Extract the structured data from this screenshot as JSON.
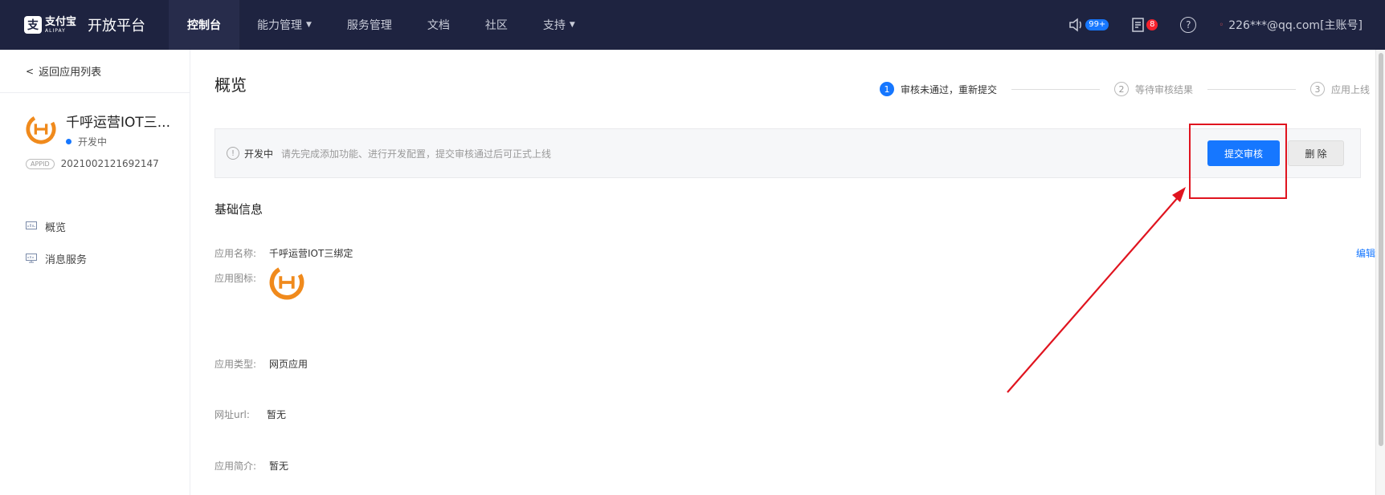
{
  "nav": {
    "brand_cn": "支付宝",
    "brand_en": "ALIPAY",
    "title": "开放平台",
    "items": [
      {
        "label": "控制台",
        "active": true,
        "dropdown": false
      },
      {
        "label": "能力管理",
        "active": false,
        "dropdown": true
      },
      {
        "label": "服务管理",
        "active": false,
        "dropdown": false
      },
      {
        "label": "文档",
        "active": false,
        "dropdown": false
      },
      {
        "label": "社区",
        "active": false,
        "dropdown": false
      },
      {
        "label": "支持",
        "active": false,
        "dropdown": true
      }
    ],
    "notice_badge": "99+",
    "task_badge": "8",
    "help_symbol": "?",
    "user": "226***@qq.com[主账号]"
  },
  "sidebar": {
    "back_label": "返回应用列表",
    "app_name": "千呼运营IOT三...",
    "app_status": "开发中",
    "appid_tag": "APPID",
    "appid": "2021002121692147",
    "menu": [
      {
        "label": "概览",
        "icon": "chart-icon"
      },
      {
        "label": "消息服务",
        "icon": "monitor-icon"
      }
    ]
  },
  "main": {
    "title": "概览",
    "steps": [
      {
        "num": "1",
        "label": "审核未通过，重新提交",
        "active": true
      },
      {
        "num": "2",
        "label": "等待审核结果",
        "active": false
      },
      {
        "num": "3",
        "label": "应用上线",
        "active": false
      }
    ],
    "notice": {
      "icon_symbol": "!",
      "status": "开发中",
      "text": "请先完成添加功能、进行开发配置，提交审核通过后可正式上线",
      "submit_label": "提交审核",
      "delete_label": "删 除"
    },
    "section_title": "基础信息",
    "edit_label": "编辑",
    "fields": [
      {
        "label": "应用名称:",
        "value": "千呼运营IOT三绑定"
      },
      {
        "label": "应用图标:",
        "value": ""
      },
      {
        "label": "应用类型:",
        "value": "网页应用"
      },
      {
        "label": "网址url:",
        "value": "暂无"
      },
      {
        "label": "应用简介:",
        "value": "暂无"
      }
    ]
  },
  "colors": {
    "nav_bg": "#1e2340",
    "primary": "#1677ff",
    "annotation_red": "#e0141f",
    "logo_orange": "#f08a1c"
  }
}
